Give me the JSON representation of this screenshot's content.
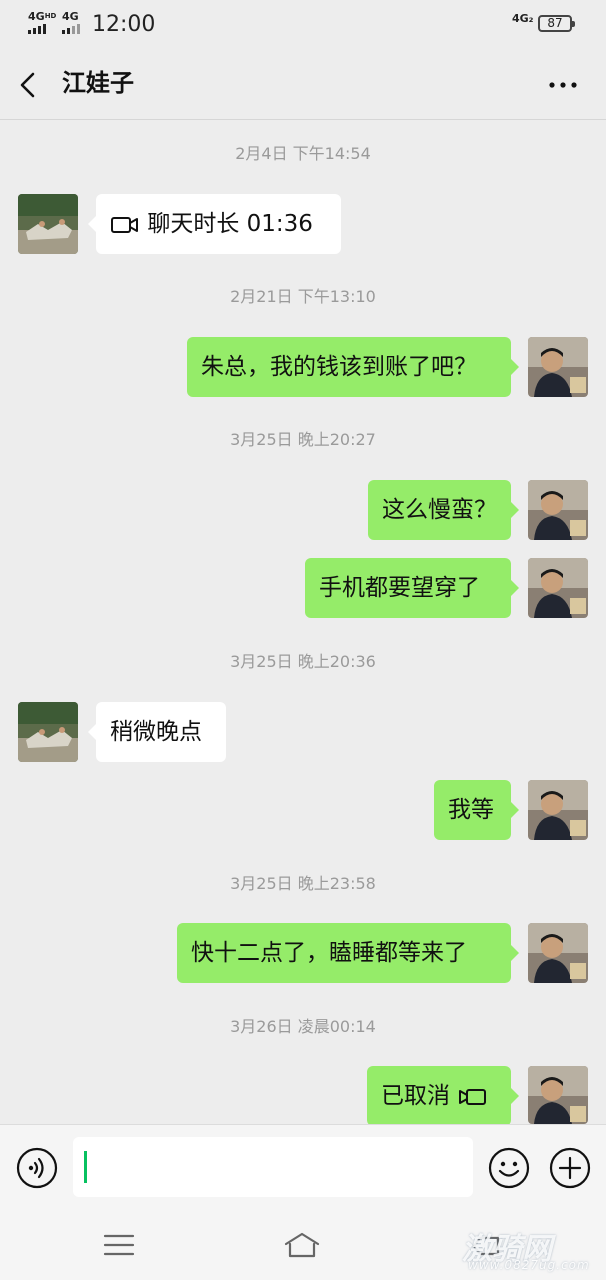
{
  "status_bar": {
    "signal_1": "4G",
    "signal_1_sup": "HD",
    "signal_2": "4G",
    "time": "12:00",
    "network": "4G₂",
    "battery": "87"
  },
  "header": {
    "title": "江娃子",
    "back_icon": "chevron-left-icon",
    "more_icon": "more-dots-icon"
  },
  "messages": [
    {
      "type": "timestamp",
      "text": "2月4日 下午14:54"
    },
    {
      "type": "in",
      "text": "聊天时长 01:36",
      "icon": "video-call-icon"
    },
    {
      "type": "timestamp",
      "text": "2月21日 下午13:10"
    },
    {
      "type": "out",
      "text": "朱总，我的钱该到账了吧？"
    },
    {
      "type": "timestamp",
      "text": "3月25日 晚上20:27"
    },
    {
      "type": "out",
      "text": "这么慢蛮？"
    },
    {
      "type": "out",
      "text": "手机都要望穿了"
    },
    {
      "type": "timestamp",
      "text": "3月25日 晚上20:36"
    },
    {
      "type": "in",
      "text": "稍微晚点"
    },
    {
      "type": "out",
      "text": "我等"
    },
    {
      "type": "timestamp",
      "text": "3月25日 晚上23:58"
    },
    {
      "type": "out",
      "text": "快十二点了，瞌睡都等来了"
    },
    {
      "type": "timestamp",
      "text": "3月26日 凌晨00:14"
    },
    {
      "type": "out",
      "text": "已取消",
      "icon": "video-call-icon"
    }
  ],
  "input_bar": {
    "voice_icon": "voice-icon",
    "input_value": "",
    "emoji_icon": "emoji-icon",
    "plus_icon": "plus-icon"
  },
  "nav_bar": {
    "menu_icon": "menu-icon",
    "home_icon": "home-icon",
    "back_icon": "back-icon"
  },
  "watermark": {
    "text": "激骑网",
    "url": "www.0827ug.com"
  },
  "colors": {
    "bubble_out": "#95ec69",
    "bubble_in": "#ffffff",
    "background": "#ededed",
    "caret": "#07c160"
  }
}
